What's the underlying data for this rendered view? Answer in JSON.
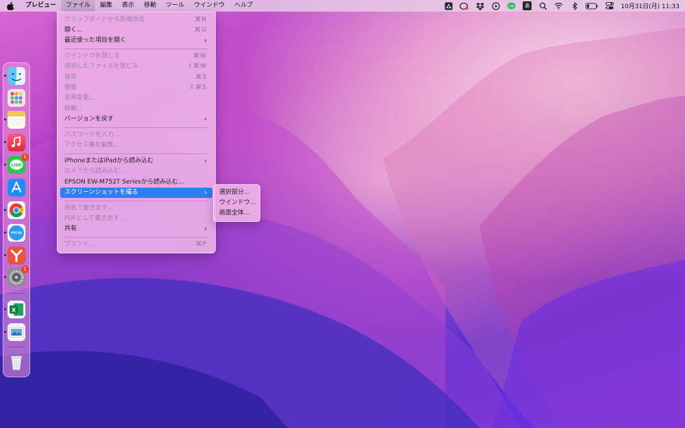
{
  "menubar": {
    "app_name": "プレビュー",
    "menus": [
      "ファイル",
      "編集",
      "表示",
      "移動",
      "ツール",
      "ウインドウ",
      "ヘルプ"
    ],
    "active_menu": "ファイル",
    "status_icons": [
      "creative-cloud-icon",
      "line-icon",
      "dropbox-icon",
      "play-icon",
      "line-chat-icon",
      "input-method-icon",
      "search-icon",
      "wifi-icon",
      "bluetooth-icon",
      "battery-icon",
      "control-center-icon"
    ],
    "input_method_glyph": "あ",
    "clock": "10月31日(月)  11:33"
  },
  "file_menu": {
    "items": [
      {
        "label": "クリップボードから新規作成",
        "shortcut": "⌘N",
        "disabled": true
      },
      {
        "label": "開く...",
        "shortcut": "⌘O",
        "disabled": false
      },
      {
        "label": "最近使った項目を開く",
        "submenu": true,
        "disabled": false
      },
      {
        "label": "ウインドウを閉じる",
        "shortcut": "⌘W",
        "disabled": true
      },
      {
        "label": "選択したファイルを閉じる",
        "shortcut": "⇧⌘W",
        "disabled": true
      },
      {
        "label": "保存",
        "shortcut": "⌘S",
        "disabled": true
      },
      {
        "label": "複製",
        "shortcut": "⇧⌘S",
        "disabled": true
      },
      {
        "label": "名称変更...",
        "disabled": true
      },
      {
        "label": "移動...",
        "disabled": true
      },
      {
        "label": "バージョンを戻す",
        "submenu": true,
        "disabled": false
      },
      {
        "label": "パスワードを入力...",
        "disabled": true
      },
      {
        "label": "アクセス権を編集...",
        "disabled": true
      },
      {
        "label": "iPhoneまたはiPadから読み込む",
        "submenu": true,
        "disabled": false
      },
      {
        "label": "カメラから読み込む...",
        "disabled": true
      },
      {
        "label": "EPSON EW-M752T Seriesから読み込む...",
        "disabled": false
      },
      {
        "label": "スクリーンショットを撮る",
        "submenu": true,
        "highlighted": true,
        "disabled": false
      },
      {
        "label": "別名で書き出す...",
        "disabled": true
      },
      {
        "label": "PDFとして書き出す...",
        "disabled": true
      },
      {
        "label": "共有",
        "submenu": true,
        "disabled": false
      },
      {
        "label": "プリント...",
        "shortcut": "⌘P",
        "disabled": true
      }
    ]
  },
  "screenshot_submenu": {
    "items": [
      "選択部分...",
      "ウインドウ...",
      "画面全体..."
    ]
  },
  "dock": {
    "apps": [
      {
        "name": "Finder",
        "icon": "finder-icon",
        "running": true
      },
      {
        "name": "Launchpad",
        "icon": "launchpad-icon",
        "running": false
      },
      {
        "name": "Notes",
        "icon": "notes-icon",
        "running": true
      },
      {
        "name": "Music",
        "icon": "music-icon",
        "running": true
      },
      {
        "name": "LINE",
        "icon": "line-icon",
        "running": true,
        "badge": "1",
        "glyph": "LINE"
      },
      {
        "name": "App Store",
        "icon": "app-store-icon",
        "running": false
      },
      {
        "name": "Chrome",
        "icon": "chrome-icon",
        "running": true
      },
      {
        "name": "Focus",
        "icon": "focus-icon",
        "running": true,
        "glyph": "FOCUS"
      },
      {
        "name": "XMind",
        "icon": "xmind-icon",
        "running": true
      },
      {
        "name": "System Preferences",
        "icon": "gear-icon",
        "running": true,
        "badge": "1"
      },
      {
        "name": "Excel",
        "icon": "excel-icon",
        "running": true,
        "glyph": "X"
      },
      {
        "name": "Preview",
        "icon": "preview-icon",
        "running": true
      },
      {
        "name": "Trash",
        "icon": "trash-icon",
        "running": false
      }
    ]
  },
  "colors": {
    "highlight": "#2f7ef1",
    "badge": "#e8432f"
  }
}
